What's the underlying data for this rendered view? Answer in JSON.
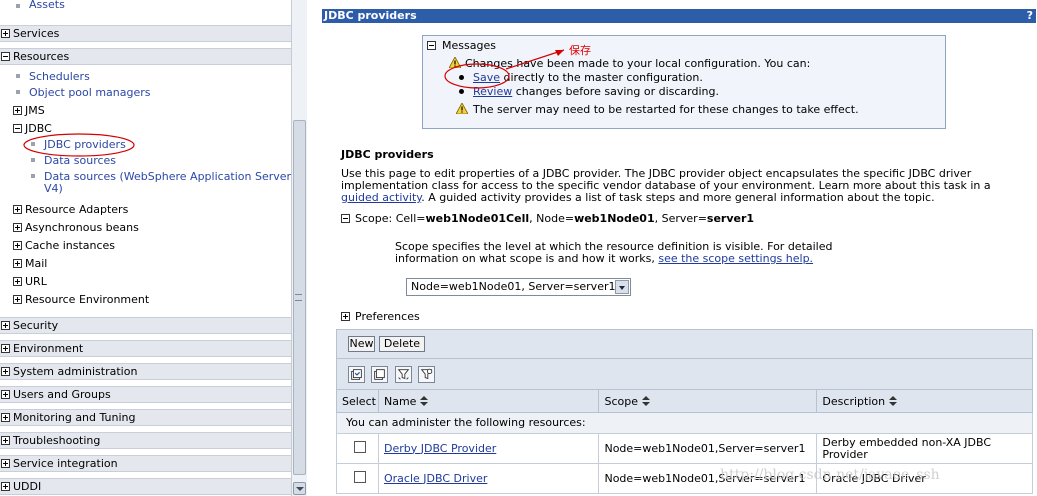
{
  "nav": {
    "assets": "Assets",
    "services": "Services",
    "resources": "Resources",
    "schedulers": "Schedulers",
    "object_pool_managers": "Object pool managers",
    "jms": "JMS",
    "jdbc": "JDBC",
    "jdbc_providers": "JDBC providers",
    "data_sources": "Data sources",
    "data_sources_was": "Data sources (WebSphere Application Server",
    "data_sources_was_2": "V4)",
    "resource_adapters": "Resource Adapters",
    "asynchronous_beans": "Asynchronous beans",
    "cache_instances": "Cache instances",
    "mail": "Mail",
    "url": "URL",
    "resource_environment": "Resource Environment",
    "security": "Security",
    "environment": "Environment",
    "system_administration": "System administration",
    "users_and_groups": "Users and Groups",
    "monitoring_and_tuning": "Monitoring and Tuning",
    "troubleshooting": "Troubleshooting",
    "service_integration": "Service integration",
    "uddi": "UDDI"
  },
  "panel": {
    "title": "JDBC providers",
    "help": "?"
  },
  "messages": {
    "header": "Messages",
    "changes": "Changes have been made to your local configuration. You can:",
    "save_link": "Save",
    "save_rest": " directly to the master configuration.",
    "review_link": "Review",
    "review_rest": " changes before saving or discarding.",
    "restart": "The server may need to be restarted for these changes to take effect.",
    "annotation": "保存"
  },
  "page": {
    "heading": "JDBC providers",
    "desc_1": "Use this page to edit properties of a JDBC provider. The JDBC provider object encapsulates the specific JDBC driver implementation class for access to the specific vendor database of your environment. Learn more about this task in a ",
    "desc_link": "guided activity",
    "desc_2": ". A guided activity provides a list of task steps and more general information about the topic.",
    "scope_prefix": "Scope: Cell=",
    "scope_cell": "web1Node01Cell",
    "scope_node_prefix": ", Node=",
    "scope_node": "web1Node01",
    "scope_server_prefix": ", Server=",
    "scope_server": "server1",
    "scope_desc": "Scope specifies the level at which the resource definition is visible. For detailed information on what scope is and how it works, ",
    "scope_link": "see the scope settings help.",
    "scope_select": "Node=web1Node01, Server=server1",
    "preferences": "Preferences"
  },
  "toolbar": {
    "new_label": "New",
    "delete_label": "Delete"
  },
  "table": {
    "headers": {
      "select": "Select",
      "name": "Name",
      "scope": "Scope",
      "description": "Description"
    },
    "info": "You can administer the following resources:",
    "rows": [
      {
        "name": "Derby JDBC Provider",
        "scope": "Node=web1Node01,Server=server1",
        "description": "Derby embedded non-XA JDBC Provider"
      },
      {
        "name": "Oracle JDBC Driver",
        "scope": "Node=web1Node01,Server=server1",
        "description": "Oracle JDBC Driver"
      }
    ]
  },
  "watermark": "http://blog.csdn.net/javaee_ssh",
  "colors": {
    "title_bar": "#2d5ca8",
    "annotation": "#e00000",
    "link": "#1f3a9c"
  }
}
